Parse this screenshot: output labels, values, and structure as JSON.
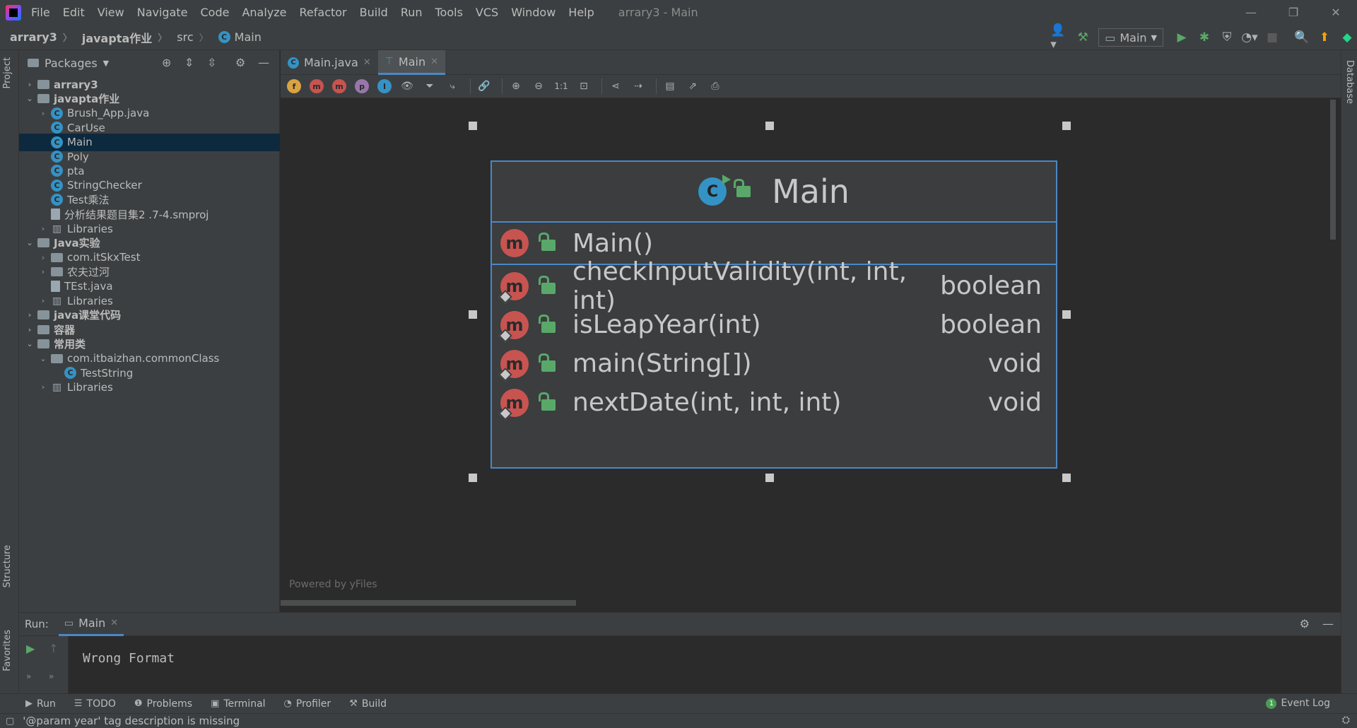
{
  "menu": {
    "items": [
      "File",
      "Edit",
      "View",
      "Navigate",
      "Code",
      "Analyze",
      "Refactor",
      "Build",
      "Run",
      "Tools",
      "VCS",
      "Window",
      "Help"
    ],
    "window_title": "arrary3 - Main"
  },
  "breadcrumb": [
    "arrary3",
    "javapta作业",
    "src",
    "Main"
  ],
  "run_config": {
    "selected": "Main"
  },
  "left_strip": {
    "project": "Project",
    "structure": "Structure",
    "favorites": "Favorites"
  },
  "right_strip": {
    "database": "Database"
  },
  "project": {
    "header": "Packages",
    "tree": [
      {
        "label": "arrary3",
        "depth": 0,
        "expand": "collapsed",
        "icon": "folder",
        "bold": true
      },
      {
        "label": "javapta作业",
        "depth": 0,
        "expand": "expanded",
        "icon": "folder",
        "bold": true
      },
      {
        "label": "Brush_App.java",
        "depth": 1,
        "expand": "collapsed",
        "icon": "class"
      },
      {
        "label": "CarUse",
        "depth": 1,
        "expand": "none",
        "icon": "class"
      },
      {
        "label": "Main",
        "depth": 1,
        "expand": "none",
        "icon": "class",
        "selected": true
      },
      {
        "label": "Poly",
        "depth": 1,
        "expand": "none",
        "icon": "class"
      },
      {
        "label": "pta",
        "depth": 1,
        "expand": "none",
        "icon": "class"
      },
      {
        "label": "StringChecker",
        "depth": 1,
        "expand": "none",
        "icon": "class"
      },
      {
        "label": "Test乘法",
        "depth": 1,
        "expand": "none",
        "icon": "class"
      },
      {
        "label": "分析结果题目集2 .7-4.smproj",
        "depth": 1,
        "expand": "none",
        "icon": "file"
      },
      {
        "label": "Libraries",
        "depth": 1,
        "expand": "collapsed",
        "icon": "library"
      },
      {
        "label": "Java实验",
        "depth": 0,
        "expand": "expanded",
        "icon": "folder",
        "bold": true
      },
      {
        "label": "com.itSkxTest",
        "depth": 1,
        "expand": "collapsed",
        "icon": "package"
      },
      {
        "label": "农夫过河",
        "depth": 1,
        "expand": "collapsed",
        "icon": "package"
      },
      {
        "label": "TEst.java",
        "depth": 1,
        "expand": "none",
        "icon": "file"
      },
      {
        "label": "Libraries",
        "depth": 1,
        "expand": "collapsed",
        "icon": "library"
      },
      {
        "label": "java课堂代码",
        "depth": 0,
        "expand": "collapsed",
        "icon": "folder",
        "bold": true
      },
      {
        "label": "容器",
        "depth": 0,
        "expand": "collapsed",
        "icon": "folder",
        "bold": true
      },
      {
        "label": "常用类",
        "depth": 0,
        "expand": "expanded",
        "icon": "folder",
        "bold": true
      },
      {
        "label": "com.itbaizhan.commonClass",
        "depth": 1,
        "expand": "expanded",
        "icon": "package"
      },
      {
        "label": "TestString",
        "depth": 2,
        "expand": "none",
        "icon": "class"
      },
      {
        "label": "Libraries",
        "depth": 1,
        "expand": "collapsed",
        "icon": "library"
      }
    ]
  },
  "editor_tabs": [
    {
      "label": "Main.java",
      "active": false
    },
    {
      "label": "Main",
      "active": true
    }
  ],
  "diagram_toolbar": {
    "filters": [
      {
        "letter": "f",
        "color": "#d9a343"
      },
      {
        "letter": "m",
        "color": "#c75450"
      },
      {
        "letter": "m",
        "color": "#c75450"
      },
      {
        "letter": "p",
        "color": "#9876aa"
      },
      {
        "letter": "I",
        "color": "#3592c4"
      }
    ],
    "zoom_actual": "1:1"
  },
  "uml": {
    "class_name": "Main",
    "constructors": [
      {
        "signature": "Main()",
        "return_type": "",
        "static": false
      }
    ],
    "methods": [
      {
        "signature": "checkInputValidity(int, int, int)",
        "return_type": "boolean",
        "static": true
      },
      {
        "signature": "isLeapYear(int)",
        "return_type": "boolean",
        "static": true
      },
      {
        "signature": "main(String[])",
        "return_type": "void",
        "static": true
      },
      {
        "signature": "nextDate(int, int, int)",
        "return_type": "void",
        "static": true
      }
    ]
  },
  "canvas": {
    "powered_by": "Powered by yFiles"
  },
  "run_panel": {
    "label": "Run:",
    "tab": "Main",
    "output": "Wrong Format"
  },
  "bottom_tabs": [
    "Run",
    "TODO",
    "Problems",
    "Terminal",
    "Profiler",
    "Build"
  ],
  "event_log": {
    "label": "Event Log",
    "count": "1"
  },
  "status": {
    "message": "'@param year' tag description is missing"
  },
  "colors": {
    "accent": "#4a88c7",
    "class_icon": "#3592c4",
    "method_icon": "#c75450",
    "public_lock": "#59a869",
    "selection": "#0d293e"
  }
}
